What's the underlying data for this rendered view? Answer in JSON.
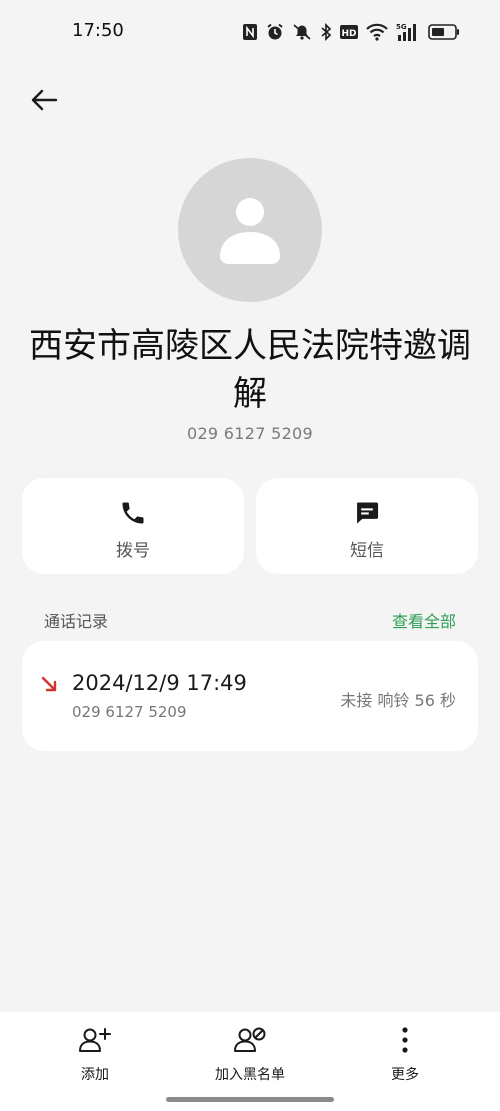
{
  "status_bar": {
    "time": "17:50",
    "network_label": "5G",
    "hd_label": "HD",
    "icons": [
      "nfc-icon",
      "alarm-icon",
      "mute-icon",
      "bluetooth-icon",
      "hd-icon",
      "wifi-icon",
      "signal-5g-icon",
      "battery-icon"
    ]
  },
  "contact": {
    "name": "西安市高陵区人民法院特邀调解",
    "number": "029 6127 5209"
  },
  "actions": {
    "call_label": "拨号",
    "sms_label": "短信"
  },
  "call_log": {
    "title": "通话记录",
    "view_all": "查看全部",
    "entries": [
      {
        "datetime": "2024/12/9 17:49",
        "number": "029 6127 5209",
        "status": "未接  响铃 56 秒",
        "type": "missed-incoming"
      }
    ]
  },
  "bottom_bar": {
    "add_label": "添加",
    "block_label": "加入黑名单",
    "more_label": "更多"
  },
  "colors": {
    "background": "#f4f4f4",
    "card": "#ffffff",
    "accent_green": "#2f9e56",
    "missed_red": "#d0342c",
    "avatar_bg": "#d6d6d6"
  }
}
